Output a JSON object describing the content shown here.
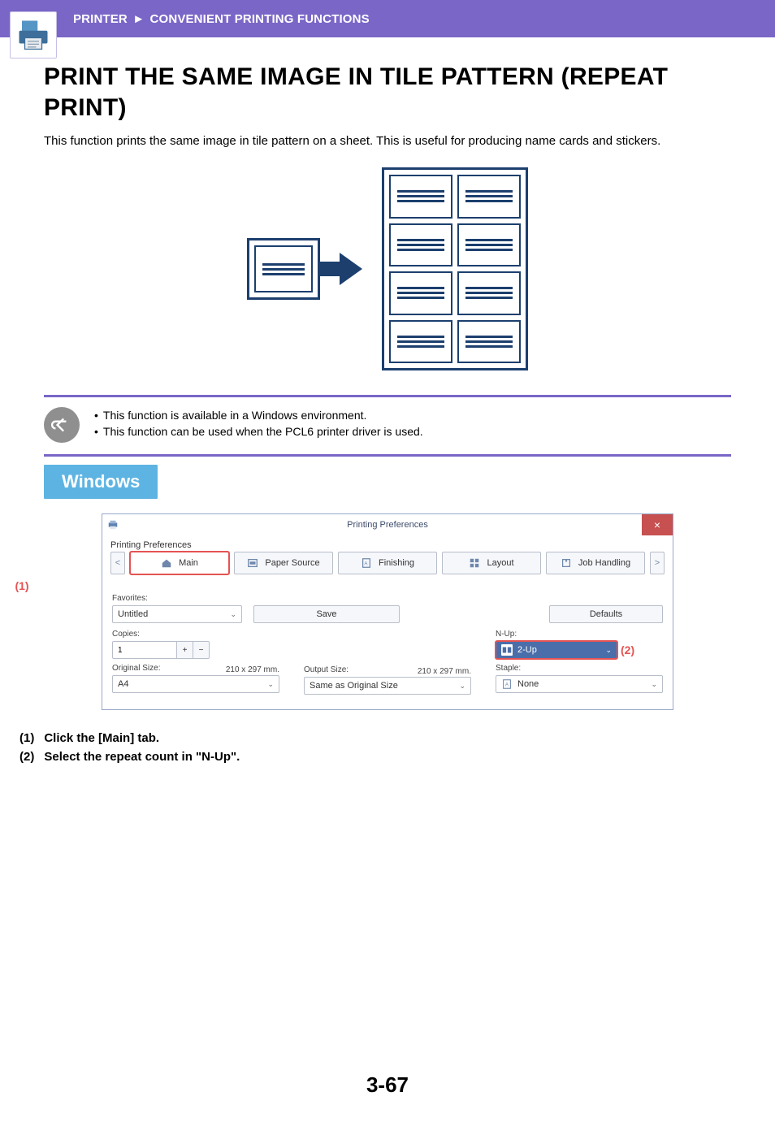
{
  "breadcrumb": {
    "section": "PRINTER",
    "page": "CONVENIENT PRINTING FUNCTIONS"
  },
  "heading": "PRINT THE SAME IMAGE IN TILE PATTERN (REPEAT PRINT)",
  "intro": "This function prints the same image in tile pattern on a sheet. This is useful for producing name cards and stickers.",
  "notes": {
    "n1": "This function is available in a Windows environment.",
    "n2": "This function can be used when the PCL6 printer driver is used."
  },
  "os_badge": "Windows",
  "dialog": {
    "title": "Printing Preferences",
    "subtitle": "Printing Preferences",
    "tabs": {
      "main": "Main",
      "paper": "Paper Source",
      "finishing": "Finishing",
      "layout": "Layout",
      "job": "Job Handling"
    },
    "favorites_label": "Favorites:",
    "favorites_value": "Untitled",
    "save_btn": "Save",
    "defaults_btn": "Defaults",
    "copies_label": "Copies:",
    "copies_value": "1",
    "original_label": "Original Size:",
    "original_value": "A4",
    "original_dim": "210 x 297 mm.",
    "output_label": "Output Size:",
    "output_value": "Same as Original Size",
    "output_dim": "210 x 297 mm.",
    "nup_label": "N-Up:",
    "nup_value": "2-Up",
    "staple_label": "Staple:",
    "staple_value": "None"
  },
  "callouts": {
    "c1": "(1)",
    "c2": "(2)"
  },
  "steps": {
    "s1num": "(1)",
    "s1": "Click the [Main] tab.",
    "s2num": "(2)",
    "s2": "Select the repeat count in \"N-Up\"."
  },
  "pagenum": "3-67"
}
